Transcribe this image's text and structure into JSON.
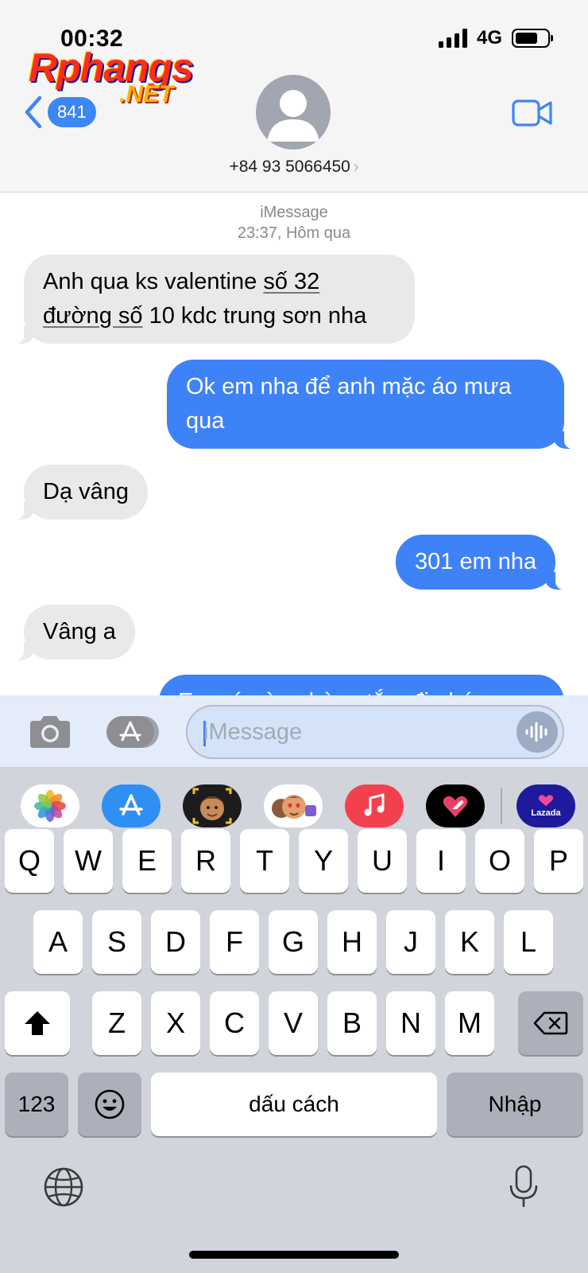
{
  "status_bar": {
    "time": "00:32",
    "network": "4G",
    "battery_level": 0.7
  },
  "watermark": {
    "line1": "Rphangs",
    "line2": ".NET"
  },
  "header": {
    "back_count": "841",
    "contact": "+84 93 5066450",
    "chevron": "›",
    "icons": [
      "chevron-left-icon",
      "contact-avatar-icon",
      "video-camera-icon"
    ]
  },
  "thread": {
    "service": "iMessage",
    "timestamp": "23:37, Hôm qua",
    "messages": [
      {
        "dir": "in",
        "parts": [
          "Anh qua ks valentine ",
          "số 32",
          " ",
          "đường số",
          " 10 kdc trung sơn nha"
        ]
      },
      {
        "dir": "out",
        "text": "Ok em nha để anh mặc áo mưa qua"
      },
      {
        "dir": "in",
        "text": "Dạ vâng"
      },
      {
        "dir": "out",
        "text": "301 em nha"
      },
      {
        "dir": "in",
        "text": "Vâng a"
      },
      {
        "dir": "out",
        "text": "Em cứ vào phòng tắm đi nhé"
      }
    ]
  },
  "composer": {
    "placeholder": "iMessage",
    "value": ""
  },
  "app_drawer": {
    "items": [
      "Ảnh",
      "App Store",
      "Memoji",
      "Memoji Stickers",
      "Nhạc",
      "Digital Touch",
      "Lazada"
    ],
    "lazada_label": "Lazada"
  },
  "keyboard": {
    "row1": [
      "Q",
      "W",
      "E",
      "R",
      "T",
      "Y",
      "U",
      "I",
      "O",
      "P"
    ],
    "row2": [
      "A",
      "S",
      "D",
      "F",
      "G",
      "H",
      "J",
      "K",
      "L"
    ],
    "row3": [
      "Z",
      "X",
      "C",
      "V",
      "B",
      "N",
      "M"
    ],
    "numbers_key": "123",
    "space_key": "dấu cách",
    "return_key": "Nhập"
  },
  "colors": {
    "accent": "#3e82f7",
    "bubble_in": "#e9e9eb",
    "keyboard_bg": "#d1d4db"
  }
}
